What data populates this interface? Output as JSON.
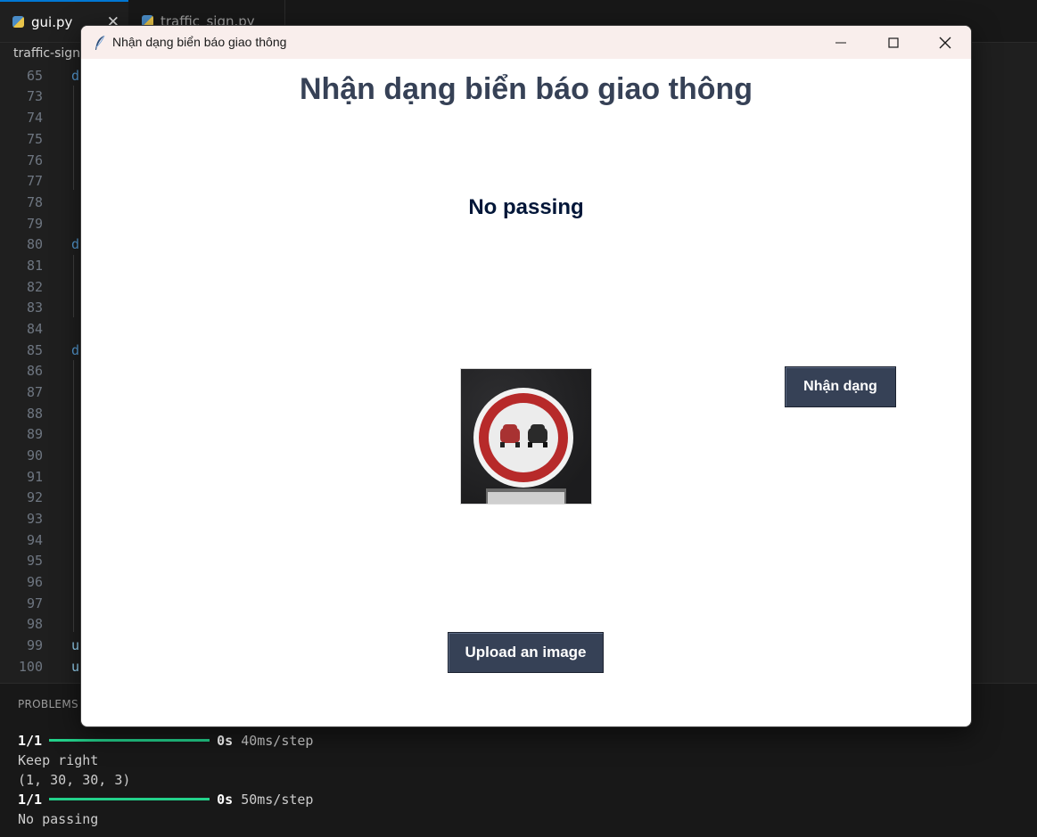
{
  "editor": {
    "tabs": [
      {
        "label": "gui.py",
        "active": true
      },
      {
        "label": "traffic_sign.py",
        "active": false
      }
    ],
    "breadcrumb": "traffic-sign",
    "line_numbers": [
      "65",
      "73",
      "74",
      "75",
      "76",
      "77",
      "78",
      "79",
      "80",
      "81",
      "82",
      "83",
      "84",
      "85",
      "86",
      "87",
      "88",
      "89",
      "90",
      "91",
      "92",
      "93",
      "94",
      "95",
      "96",
      "97",
      "98",
      "99",
      "100"
    ],
    "code_fragments": {
      "l65": "d",
      "l80": "d",
      "l85": "d",
      "l99": "u",
      "l100": "u"
    }
  },
  "panel": {
    "tab_label": "PROBLEMS",
    "terminal": [
      {
        "count": "1/1",
        "time": "0s",
        "rate": "40ms/step"
      },
      {
        "text": "Keep right"
      },
      {
        "text": "(1, 30, 30, 3)"
      },
      {
        "count": "1/1",
        "time": "0s",
        "rate": "50ms/step"
      },
      {
        "text": "No passing"
      }
    ]
  },
  "app": {
    "window_title": "Nhận dạng biển báo giao thông",
    "heading": "Nhận dạng biển báo giao thông",
    "result_label": "No passing",
    "classify_button": "Nhận dạng",
    "upload_button": "Upload an image",
    "image_alt": "no-passing-sign",
    "colors": {
      "heading": "#364156",
      "button_bg": "#364156",
      "result": "#011638",
      "progress": "#23d18b"
    }
  }
}
